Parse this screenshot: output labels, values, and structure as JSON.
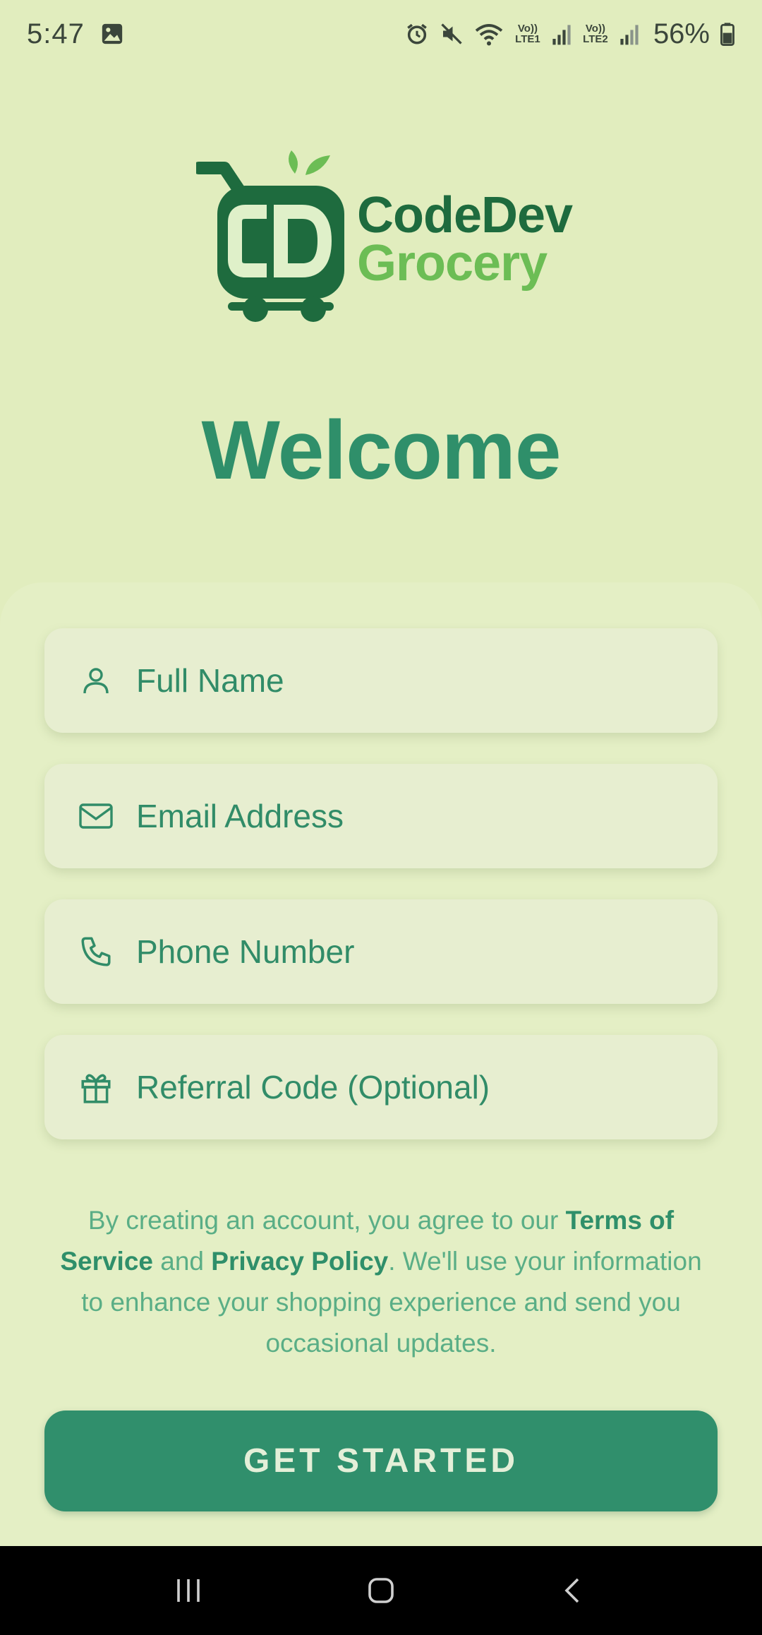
{
  "status_bar": {
    "time": "5:47",
    "battery": "56%",
    "net1": "Vo)) LTE1",
    "net2": "Vo)) LTE2",
    "icons": [
      "gallery-icon",
      "alarm-icon",
      "mute-icon",
      "wifi-icon",
      "signal-icon",
      "signal-icon",
      "battery-icon"
    ]
  },
  "logo": {
    "mark": "CD",
    "line1": "CodeDev",
    "line2": "Grocery",
    "colors": {
      "dark_green": "#1e6b3e",
      "light_green": "#6cbd55"
    }
  },
  "title": "Welcome",
  "form": {
    "full_name_placeholder": "Full Name",
    "email_placeholder": "Email Address",
    "phone_placeholder": "Phone Number",
    "referral_placeholder": "Referral Code (Optional)"
  },
  "terms": {
    "part1": "By creating an account, you agree to our ",
    "terms_link": "Terms of Service",
    "part2": " and ",
    "privacy_link": "Privacy Policy",
    "part3": ". We'll use your information to enhance your shopping experience and send you occasional updates."
  },
  "cta_label": "GET STARTED",
  "colors": {
    "background": "#e1edbe",
    "accent": "#2f8f6a",
    "button": "#308f6c"
  }
}
